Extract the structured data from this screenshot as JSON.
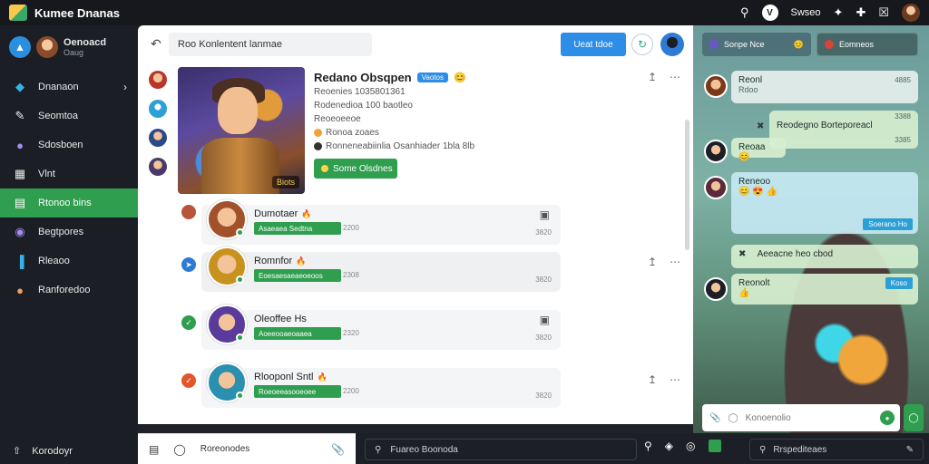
{
  "app": {
    "title": "Kumee Dnanas"
  },
  "topbar": {
    "user_label": "Swseo"
  },
  "sidebar": {
    "profile_name": "Oenoacd",
    "profile_sub": "Oaug",
    "items": [
      {
        "label": "Dnanaon",
        "icon": "chart-icon"
      },
      {
        "label": "Seomtoa",
        "icon": "edit-icon"
      },
      {
        "label": "Sdosboen",
        "icon": "avatar-icon"
      },
      {
        "label": "Vlnt",
        "icon": "bookmark-icon"
      },
      {
        "label": "Rtonoo bins",
        "icon": "list-icon",
        "active": true
      },
      {
        "label": "Begtpores",
        "icon": "circle-icon"
      },
      {
        "label": "Rleaoo",
        "icon": "bars-icon"
      },
      {
        "label": "Ranforedoo",
        "icon": "avatar-icon"
      }
    ],
    "footer_label": "Korodoyr"
  },
  "main": {
    "search_value": "Roo Konlentent lanmae",
    "primary_button": "Ueat tdoe",
    "detail": {
      "title": "Redano Obsqpen",
      "badge": "Vaotos",
      "line1": "Reoenies 1035801361",
      "line2": "Rodenedioa 100 baotleo",
      "line3": "Reoeoeeoe",
      "line4": "Ronoa zoaes",
      "line5": "Ronneneabiinlia Osanhiader 1bla 8lb",
      "button": "Some Olsdnes",
      "image_tag": "Biots"
    },
    "rows": [
      {
        "name": "Dumotaer",
        "badge": "Asaeaea Sedtna",
        "meta": "2200",
        "time": "3820"
      },
      {
        "name": "Romnfor",
        "badge": "Eoesaesaeaeoeoos",
        "meta": "2308",
        "time": "3820"
      },
      {
        "name": "Oleoffee Hs",
        "badge": "Aoeeooaeoaaea",
        "meta": "2320",
        "time": "3820"
      },
      {
        "name": "Rlooponl Sntl",
        "badge": "Roeoeeasooeoee",
        "meta": "2200",
        "time": "3820"
      }
    ]
  },
  "bottom": {
    "left_label": "Roreonodes",
    "search_placeholder": "Fuareo Boonoda",
    "right_search": "Rrspediteaes"
  },
  "chat": {
    "tab_a": "Sonpe Nce",
    "tab_b": "Eomneos",
    "messages": [
      {
        "author": "Reonl",
        "text": "Rdoo",
        "time": "4885"
      },
      {
        "author": "",
        "text": "Reodegno Borteporeacl",
        "time": "3388",
        "time2": "3385"
      },
      {
        "author": "Reoaa",
        "text": "",
        "time": ""
      },
      {
        "author": "Reneoo",
        "text": "",
        "chip": "Soerano Ho"
      },
      {
        "author": "",
        "text": "Aeeacne heo cbod",
        "time": ""
      },
      {
        "author": "Reonolt",
        "text": "",
        "chip": "Koso"
      }
    ],
    "input_placeholder": "Konoenolio"
  }
}
